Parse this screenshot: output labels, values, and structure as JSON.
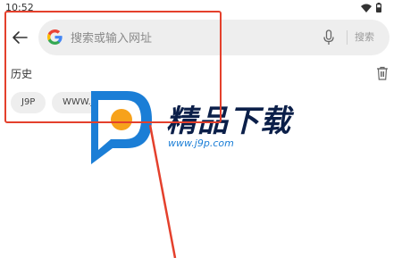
{
  "status_bar": {
    "time": "10:52",
    "icons": [
      "wifi-icon",
      "battery-icon"
    ]
  },
  "search": {
    "placeholder": "搜索或输入网址",
    "value": "",
    "button_label": "搜索",
    "icons": [
      "back-icon",
      "google-icon",
      "mic-icon"
    ]
  },
  "history": {
    "title": "历史",
    "clear_icon": "trash-icon",
    "chips": [
      "J9P",
      "WWW.J9P.COM"
    ]
  },
  "watermark": {
    "title": "精品下载",
    "url": "www.j9p.com"
  },
  "colors": {
    "accent": "#e4402c",
    "search_bg": "#eeeeee",
    "watermark_blue": "#1b7ed6",
    "watermark_dark": "#0b1f49"
  }
}
